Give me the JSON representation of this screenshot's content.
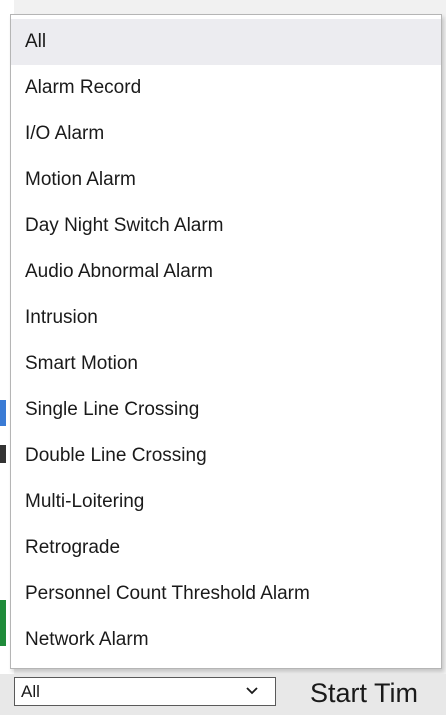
{
  "dropdown": {
    "options": [
      "All",
      "Alarm Record",
      "I/O Alarm",
      "Motion Alarm",
      "Day Night Switch Alarm",
      "Audio Abnormal Alarm",
      "Intrusion",
      "Smart Motion",
      "Single Line Crossing",
      "Double Line Crossing",
      "Multi-Loitering",
      "Retrograde",
      "Personnel Count Threshold Alarm",
      "Network Alarm"
    ],
    "selected_index": 0
  },
  "filter": {
    "selected_value": "All",
    "icon": "chevron-down-icon"
  },
  "start_time_label": "Start Tim",
  "colors": {
    "selected_bg": "#ececf0",
    "strip_mark_blue": "#3a7bd5",
    "strip_mark_green": "#1f8b3a",
    "strip_mark_dark": "#333333"
  }
}
